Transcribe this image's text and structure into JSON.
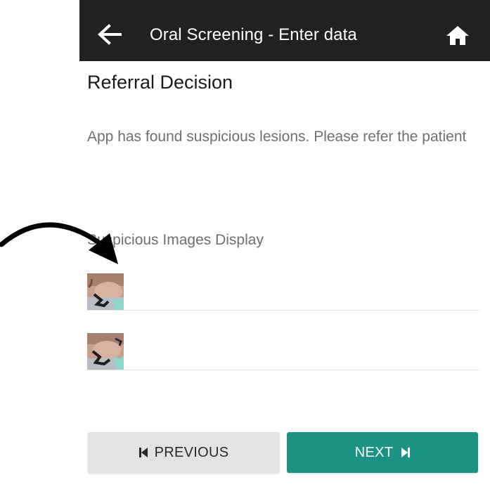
{
  "header": {
    "title": "Oral Screening - Enter data",
    "back_icon": "arrow-left-icon",
    "home_icon": "home-icon",
    "background": "#212121"
  },
  "content": {
    "section_title": "Referral Decision",
    "message": "App has found suspicious lesions. Please refer the patient",
    "images_label": "Suspicious Images Display",
    "images": [
      {
        "icon": "lesion-image-thumbnail"
      },
      {
        "icon": "lesion-image-thumbnail"
      }
    ]
  },
  "footer": {
    "previous_label": "PREVIOUS",
    "next_label": "NEXT",
    "previous_icon": "skip-previous-icon",
    "next_icon": "skip-next-icon",
    "next_color": "#1b9384",
    "previous_color": "#e1e3e5"
  },
  "annotation": {
    "icon": "curved-arrow-pointer-icon"
  }
}
